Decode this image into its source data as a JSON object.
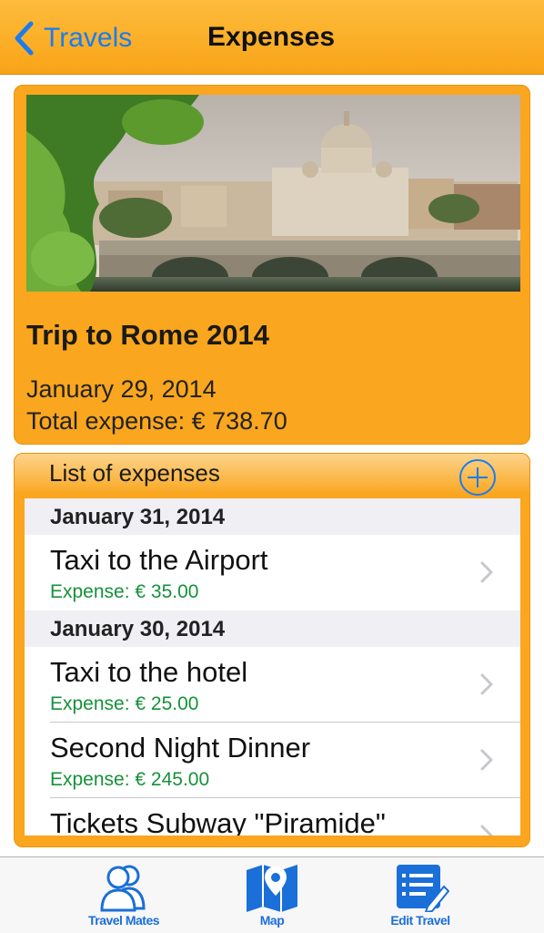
{
  "nav": {
    "back_label": "Travels",
    "title": "Expenses"
  },
  "trip": {
    "title": "Trip to Rome 2014",
    "date": "January 29, 2014",
    "total": "Total expense: € 738.70"
  },
  "expenses": {
    "header": "List of expenses",
    "sections": [
      {
        "date": "January 31, 2014",
        "items": [
          {
            "title": "Taxi to the Airport",
            "amount": "Expense: € 35.00"
          }
        ]
      },
      {
        "date": "January 30, 2014",
        "items": [
          {
            "title": "Taxi to the hotel",
            "amount": "Expense: € 25.00"
          },
          {
            "title": "Second Night Dinner",
            "amount": "Expense: € 245.00"
          },
          {
            "title": "Tickets Subway \"Piramide\"",
            "amount": ""
          }
        ]
      }
    ]
  },
  "tabs": [
    {
      "label": "Travel Mates",
      "icon": "people-icon"
    },
    {
      "label": "Map",
      "icon": "map-icon"
    },
    {
      "label": "Edit Travel",
      "icon": "edit-icon"
    }
  ],
  "colors": {
    "accent": "#faa61e",
    "link": "#1a7cf2",
    "expense_green": "#16913a",
    "tab_blue": "#1a6fd8"
  }
}
